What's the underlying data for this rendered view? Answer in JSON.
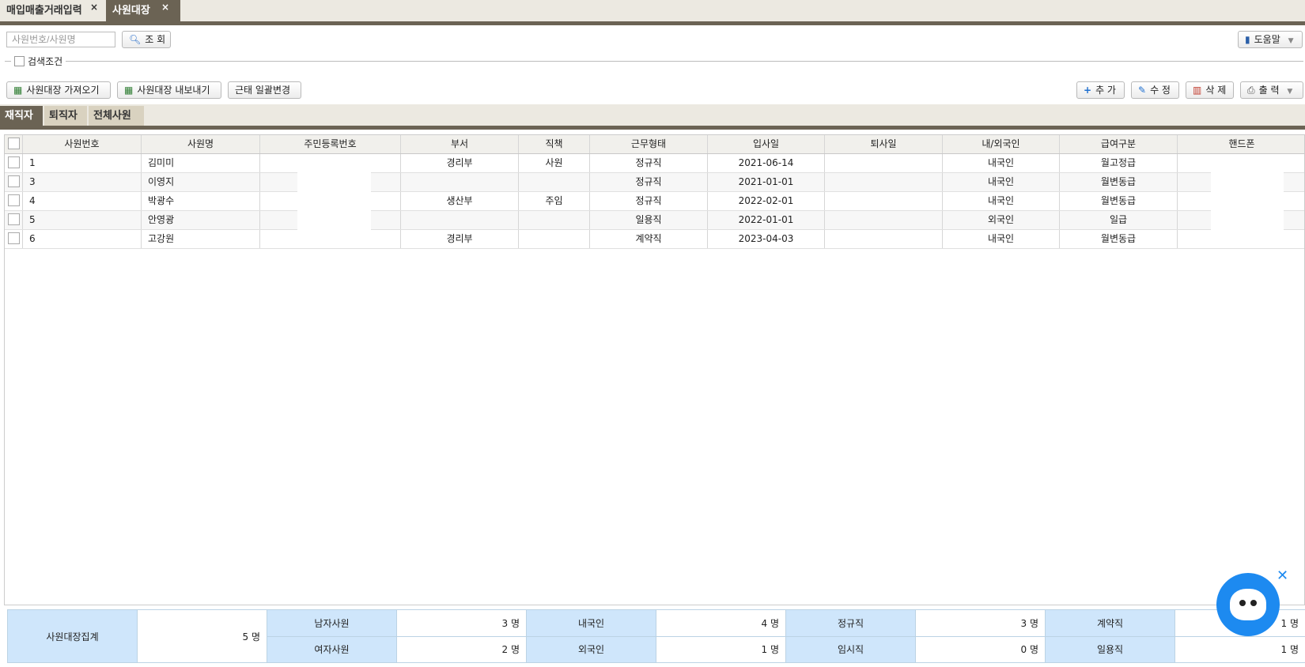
{
  "top_tabs": [
    {
      "label": "매입매출거래입력",
      "active": false
    },
    {
      "label": "사원대장",
      "active": true
    }
  ],
  "search": {
    "placeholder": "사원번호/사원명",
    "button": "조 회"
  },
  "help_button": "도움말",
  "condition_label": "검색조건",
  "toolbar_left": [
    "사원대장 가져오기",
    "사원대장 내보내기",
    "근태 일괄변경"
  ],
  "toolbar_right": {
    "add": "추 가",
    "edit": "수 정",
    "delete": "삭 제",
    "print": "출 력"
  },
  "sub_tabs": [
    {
      "label": "재직자",
      "active": true
    },
    {
      "label": "퇴직자",
      "active": false
    },
    {
      "label": "전체사원",
      "active": false
    }
  ],
  "columns": [
    "사원번호",
    "사원명",
    "주민등록번호",
    "부서",
    "직책",
    "근무형태",
    "입사일",
    "퇴사일",
    "내/외국인",
    "급여구분",
    "핸드폰"
  ],
  "rows": [
    [
      "1",
      "김미미",
      "",
      "경리부",
      "사원",
      "정규직",
      "2021-06-14",
      "",
      "내국인",
      "월고정급",
      ""
    ],
    [
      "3",
      "이영지",
      "",
      "",
      "",
      "정규직",
      "2021-01-01",
      "",
      "내국인",
      "월변동급",
      ""
    ],
    [
      "4",
      "박광수",
      "",
      "생산부",
      "주임",
      "정규직",
      "2022-02-01",
      "",
      "내국인",
      "월변동급",
      ""
    ],
    [
      "5",
      "안영광",
      "",
      "",
      "",
      "일용직",
      "2022-01-01",
      "",
      "외국인",
      "일급",
      ""
    ],
    [
      "6",
      "고강원",
      "",
      "경리부",
      "",
      "계약직",
      "2023-04-03",
      "",
      "내국인",
      "월변동급",
      ""
    ]
  ],
  "summary": {
    "title": "사원대장집계",
    "total": "5 명",
    "male_label": "남자사원",
    "male": "3 명",
    "female_label": "여자사원",
    "female": "2 명",
    "domestic_label": "내국인",
    "domestic": "4 명",
    "foreign_label": "외국인",
    "foreign": "1 명",
    "regular_label": "정규직",
    "regular": "3 명",
    "temp_label": "임시직",
    "temp": "0 명",
    "contract_label": "계약직",
    "contract": "1 명",
    "daily_label": "일용직",
    "daily": "1 명"
  },
  "colors": {
    "tab_dark": "#6b6354",
    "summary_label": "#cfe6fb",
    "bot": "#1d8af0"
  }
}
